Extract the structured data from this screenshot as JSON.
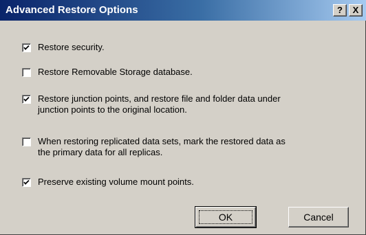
{
  "dialog": {
    "title": "Advanced Restore Options",
    "help_label": "?",
    "close_label": "X"
  },
  "options": [
    {
      "label": "Restore security.",
      "checked": true
    },
    {
      "label": "Restore Removable Storage database.",
      "checked": false
    },
    {
      "label": "Restore junction points, and restore file and folder data under\njunction points to the original location.",
      "checked": true
    },
    {
      "label": "When restoring replicated data sets, mark the restored data as\nthe primary data for all replicas.",
      "checked": false
    },
    {
      "label": "Preserve existing volume mount points.",
      "checked": true
    }
  ],
  "buttons": {
    "ok_label": "OK",
    "cancel_label": "Cancel"
  }
}
